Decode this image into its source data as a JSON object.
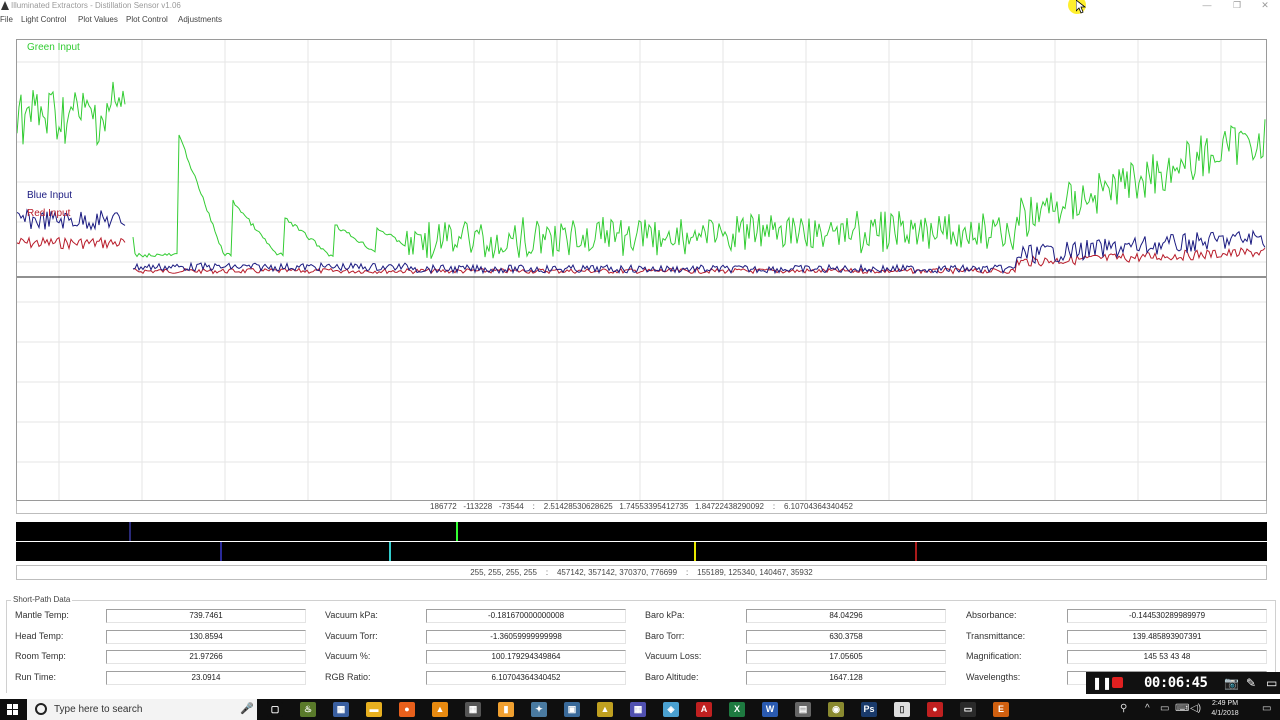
{
  "window": {
    "title": "Illuminated Extractors - Distillation Sensor  v1.06",
    "minimize_glyph": "—",
    "maximize_glyph": "❐",
    "close_glyph": "✕"
  },
  "menu": [
    "File",
    "Light Control",
    "Plot Values",
    "Plot Control",
    "Adjustments"
  ],
  "plot": {
    "legend": {
      "green": "Green Input",
      "blue": "Blue Input",
      "red": "Red Input"
    },
    "colors": {
      "green": "#33cc33",
      "blue": "#1a1a80",
      "red": "#b81c2a",
      "grid": "#e6e6e6",
      "baseline": "#202020"
    },
    "readout": "186772   -113228   -73544    :    2.51428530628625   1.74553395412735   1.84722438290092    :    6.10704364340452"
  },
  "spectrum": {
    "readout": "255, 255, 255, 255    :    457142, 357142, 370370, 776699    :    155189, 125340, 140467, 35932",
    "bar1_lines": [
      {
        "pos": 0.09,
        "color": "#2a2a7a"
      },
      {
        "pos": 0.352,
        "color": "#33ff33"
      }
    ],
    "bar2_lines": [
      {
        "pos": 0.163,
        "color": "#2a2a9a"
      },
      {
        "pos": 0.298,
        "color": "#33cccc"
      },
      {
        "pos": 0.542,
        "color": "#e8e800"
      },
      {
        "pos": 0.719,
        "color": "#aa1a1a"
      }
    ]
  },
  "short_path": {
    "title": "Short-Path Data",
    "columns": [
      [
        {
          "label": "Mantle Temp:",
          "value": "739.7461"
        },
        {
          "label": "Head Temp:",
          "value": "130.8594"
        },
        {
          "label": "Room Temp:",
          "value": "21.97266"
        },
        {
          "label": "Run Time:",
          "value": "23.0914"
        }
      ],
      [
        {
          "label": "Vacuum kPa:",
          "value": "-0.181670000000008"
        },
        {
          "label": "Vacuum Torr:",
          "value": "-1.36059999999998"
        },
        {
          "label": "Vacuum %:",
          "value": "100.179294349864"
        },
        {
          "label": "RGB Ratio:",
          "value": "6.10704364340452"
        }
      ],
      [
        {
          "label": "Baro kPa:",
          "value": "84.04296"
        },
        {
          "label": "Baro Torr:",
          "value": "630.3758"
        },
        {
          "label": "Vacuum Loss:",
          "value": "17.05605"
        },
        {
          "label": "Baro Altitude:",
          "value": "1647.128"
        }
      ],
      [
        {
          "label": "Absorbance:",
          "value": "-0.144530289989979"
        },
        {
          "label": "Transmittance:",
          "value": "139.485893907391"
        },
        {
          "label": "Magnification:",
          "value": "145    53    43    48"
        },
        {
          "label": "Wavelengths:",
          "value": ""
        }
      ]
    ]
  },
  "recorder": {
    "time": "00:06:45",
    "pause_glyph": "❚❚",
    "camera_glyph": "📷",
    "pen_glyph": "✎",
    "window_glyph": "▭"
  },
  "taskbar": {
    "search_placeholder": "Type here to search",
    "mic_glyph": "🎤",
    "apps": [
      {
        "name": "task-view",
        "glyph": "▢",
        "color": "#0f0f0f"
      },
      {
        "name": "app-1",
        "glyph": "♨",
        "color": "#5a7a2a"
      },
      {
        "name": "app-2",
        "glyph": "▦",
        "color": "#3a5fa0"
      },
      {
        "name": "file-explorer",
        "glyph": "▬",
        "color": "#e8b020"
      },
      {
        "name": "firefox",
        "glyph": "●",
        "color": "#e8601c"
      },
      {
        "name": "vlc",
        "glyph": "▲",
        "color": "#e88a10"
      },
      {
        "name": "calculator",
        "glyph": "▦",
        "color": "#555555"
      },
      {
        "name": "app-orange",
        "glyph": "▮",
        "color": "#f0a030"
      },
      {
        "name": "app-3",
        "glyph": "✦",
        "color": "#4a7aa0"
      },
      {
        "name": "app-4",
        "glyph": "▣",
        "color": "#3a6a9a"
      },
      {
        "name": "app-5",
        "glyph": "▲",
        "color": "#c0a020"
      },
      {
        "name": "app-6",
        "glyph": "▦",
        "color": "#5050b0"
      },
      {
        "name": "app-7",
        "glyph": "◈",
        "color": "#4aa0d0"
      },
      {
        "name": "acrobat",
        "glyph": "A",
        "color": "#c02020"
      },
      {
        "name": "excel",
        "glyph": "X",
        "color": "#1e7a40"
      },
      {
        "name": "word",
        "glyph": "W",
        "color": "#2a5ab0"
      },
      {
        "name": "app-8",
        "glyph": "▤",
        "color": "#666666"
      },
      {
        "name": "app-9",
        "glyph": "◉",
        "color": "#8a8a30"
      },
      {
        "name": "photoshop",
        "glyph": "Ps",
        "color": "#1a3a6a"
      },
      {
        "name": "notepad",
        "glyph": "▯",
        "color": "#dddddd"
      },
      {
        "name": "recorder-app",
        "glyph": "●",
        "color": "#c02020"
      },
      {
        "name": "app-10",
        "glyph": "▭",
        "color": "#2a2a2a"
      },
      {
        "name": "app-e",
        "glyph": "E",
        "color": "#d06010"
      }
    ],
    "tray": [
      "⚲",
      "^",
      "▭",
      "⌨",
      "◁)",
      "▭"
    ],
    "time": "2:49 PM",
    "date": "4/1/2018"
  }
}
